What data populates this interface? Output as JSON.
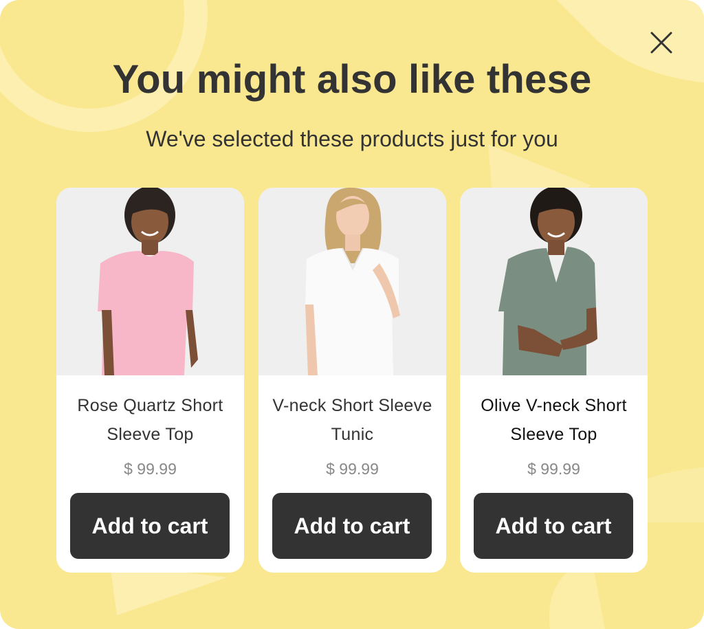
{
  "popup": {
    "title": "You might also like these",
    "subtitle": "We've selected these products just for you",
    "close_icon": "close-icon",
    "background_color": "#fae891"
  },
  "products": [
    {
      "name": "Rose Quartz Short Sleeve Top",
      "price": "$ 99.99",
      "button_label": "Add to cart",
      "shirt_color": "#f7b7c8",
      "image": "product-photo"
    },
    {
      "name": "V-neck Short Sleeve Tunic",
      "price": "$ 99.99",
      "button_label": "Add to cart",
      "shirt_color": "#fafafa",
      "image": "product-photo"
    },
    {
      "name": "Olive V-neck Short Sleeve Top",
      "price": "$ 99.99",
      "button_label": "Add to cart",
      "shirt_color": "#7a8f82",
      "image": "product-photo"
    }
  ],
  "colors": {
    "button_bg": "#333333",
    "button_text": "#ffffff",
    "price_text": "#888888"
  }
}
